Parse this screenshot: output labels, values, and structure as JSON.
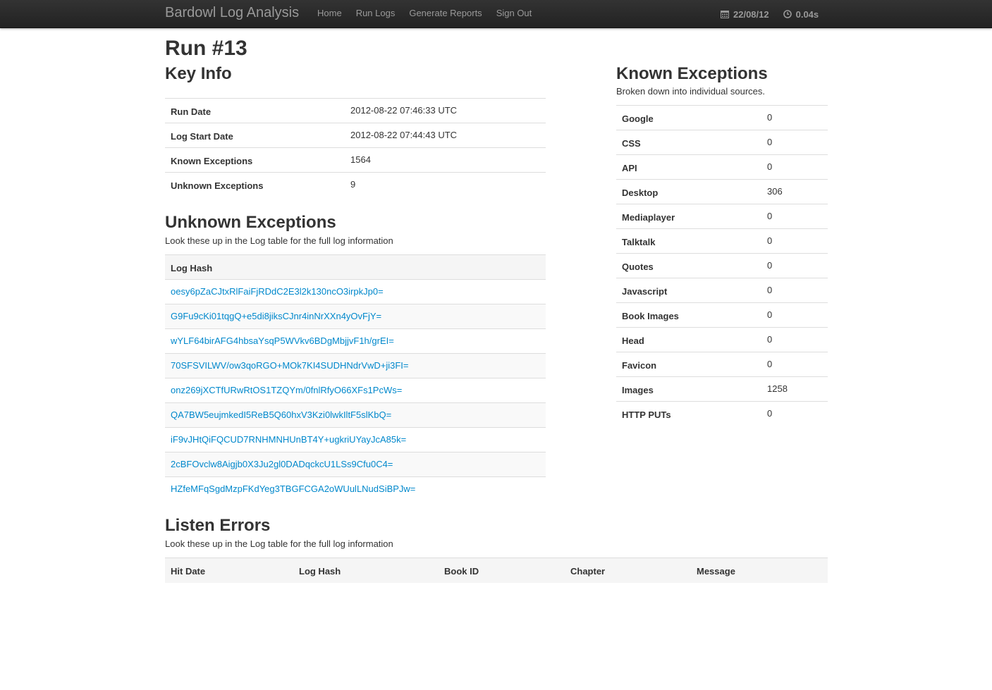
{
  "navbar": {
    "brand": "Bardowl Log Analysis",
    "items": [
      {
        "label": "Home"
      },
      {
        "label": "Run Logs"
      },
      {
        "label": "Generate Reports"
      },
      {
        "label": "Sign Out"
      }
    ],
    "date": "22/08/12",
    "date_icon": "calendar-icon",
    "time": "0.04s",
    "time_icon": "clock-icon"
  },
  "page": {
    "title": "Run #13"
  },
  "key_info": {
    "heading": "Key Info",
    "rows": [
      {
        "label": "Run Date",
        "value": "2012-08-22 07:46:33 UTC"
      },
      {
        "label": "Log Start Date",
        "value": "2012-08-22 07:44:43 UTC"
      },
      {
        "label": "Known Exceptions",
        "value": "1564"
      },
      {
        "label": "Unknown Exceptions",
        "value": "9"
      }
    ]
  },
  "unknown_exceptions": {
    "heading": "Unknown Exceptions",
    "subtitle": "Look these up in the Log table for the full log information",
    "column": "Log Hash",
    "hashes": [
      "oesy6pZaCJtxRlFaiFjRDdC2E3l2k130ncO3irpkJp0=",
      "G9Fu9cKi01tqgQ+e5di8jiksCJnr4inNrXXn4yOvFjY=",
      "wYLF64birAFG4hbsaYsqP5WVkv6BDgMbjjvF1h/grEI=",
      "70SFSVILWV/ow3qoRGO+MOk7KI4SUDHNdrVwD+ji3FI=",
      "onz269jXCTfURwRtOS1TZQYm/0fnlRfyO66XFs1PcWs=",
      "QA7BW5eujmkedI5ReB5Q60hxV3Kzi0lwkIltF5slKbQ=",
      "iF9vJHtQiFQCUD7RNHMNHUnBT4Y+ugkriUYayJcA85k=",
      "2cBFOvclw8Aigjb0X3Ju2gl0DADqckcU1LSs9Cfu0C4=",
      "HZfeMFqSgdMzpFKdYeg3TBGFCGA2oWUulLNudSiBPJw="
    ]
  },
  "known_exceptions": {
    "heading": "Known Exceptions",
    "subtitle": "Broken down into individual sources.",
    "rows": [
      {
        "label": "Google",
        "value": "0"
      },
      {
        "label": "CSS",
        "value": "0"
      },
      {
        "label": "API",
        "value": "0"
      },
      {
        "label": "Desktop",
        "value": "306"
      },
      {
        "label": "Mediaplayer",
        "value": "0"
      },
      {
        "label": "Talktalk",
        "value": "0"
      },
      {
        "label": "Quotes",
        "value": "0"
      },
      {
        "label": "Javascript",
        "value": "0"
      },
      {
        "label": "Book Images",
        "value": "0"
      },
      {
        "label": "Head",
        "value": "0"
      },
      {
        "label": "Favicon",
        "value": "0"
      },
      {
        "label": "Images",
        "value": "1258"
      },
      {
        "label": "HTTP PUTs",
        "value": "0"
      }
    ]
  },
  "listen_errors": {
    "heading": "Listen Errors",
    "subtitle": "Look these up in the Log table for the full log information",
    "columns": [
      "Hit Date",
      "Log Hash",
      "Book ID",
      "Chapter",
      "Message"
    ]
  }
}
